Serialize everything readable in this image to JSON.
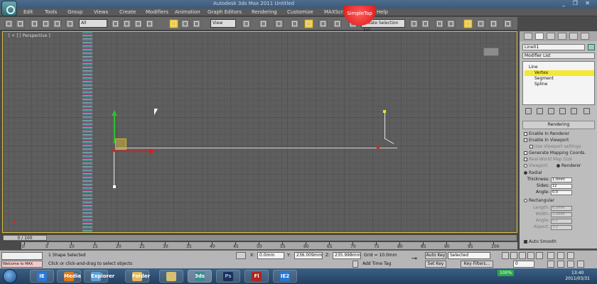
{
  "window": {
    "title": "Autodesk 3ds Max 2011    Untitled",
    "controls": "_ ❐ ✕"
  },
  "menu": {
    "items": [
      "Edit",
      "Tools",
      "Group",
      "Views",
      "Create",
      "Modifiers",
      "Animation",
      "Graph Editors",
      "Rendering",
      "Customize",
      "MAXScript",
      "Help"
    ]
  },
  "overlay": {
    "simpletap": "SimpleTap"
  },
  "toolbar": {
    "selection_filter": "All",
    "reference_coord": "View",
    "named_selection": "Create Selection Set"
  },
  "viewport": {
    "label": "[ + ] [ Perspective ]"
  },
  "command_panel": {
    "object_name": "Line01",
    "modifier_list": "Modifier List",
    "stack": [
      "Line",
      "Vertex",
      "Segment",
      "Spline"
    ],
    "rollout_title": "Rendering",
    "checkboxes": [
      {
        "label": "Enable In Renderer",
        "checked": false
      },
      {
        "label": "Enable In Viewport",
        "checked": false
      },
      {
        "label": "Use Viewport settings",
        "checked": false,
        "dim": true
      },
      {
        "label": "Generate Mapping Coords.",
        "checked": false
      },
      {
        "label": "Real-World Map Size",
        "checked": false,
        "dim": true
      }
    ],
    "mode": {
      "viewport": "Viewport",
      "renderer": "Renderer"
    },
    "radial_label": "Radial",
    "radial_params": [
      {
        "label": "Thickness:",
        "value": "1.0mm"
      },
      {
        "label": "Sides:",
        "value": "12"
      },
      {
        "label": "Angle:",
        "value": "0.0"
      }
    ],
    "rectangular_label": "Rectangular",
    "rect_params": [
      {
        "label": "Length:",
        "value": "6.0mm"
      },
      {
        "label": "Width:",
        "value": "2.0mm"
      },
      {
        "label": "Angle:",
        "value": "0.0"
      },
      {
        "label": "Aspect:",
        "value": "3.0"
      }
    ],
    "auto_smooth": "Auto Smooth"
  },
  "timeline": {
    "slider": "0 / 100",
    "ticks": [
      "0",
      "5",
      "10",
      "15",
      "20",
      "25",
      "30",
      "35",
      "40",
      "45",
      "50",
      "55",
      "60",
      "65",
      "70",
      "75",
      "80",
      "85",
      "90",
      "95",
      "100"
    ]
  },
  "status": {
    "maxscript_label": "Welcome to MAX",
    "selected": "1 Shape Selected",
    "prompt": "Click or click-and-drag to select objects",
    "x_label": "X:",
    "x": "0.0mm",
    "y_label": "Y:",
    "y": "236.009mm",
    "z_label": "Z:",
    "z": "235.998mm",
    "grid": "Grid = 10.0mm",
    "add_time_tag": "Add Time Tag",
    "auto_key": "Auto Key",
    "selected_dropdown": "Selected",
    "set_key": "Set Key",
    "key_filters": "Key Filters...",
    "frame": "0"
  },
  "taskbar": {
    "apps": [
      "IE",
      "Media",
      "Explorer",
      "Folder",
      "3ds",
      "Ps",
      "Fl",
      "IE2"
    ],
    "battery": "100%",
    "time": "13:40",
    "date": "2011/03/31"
  }
}
